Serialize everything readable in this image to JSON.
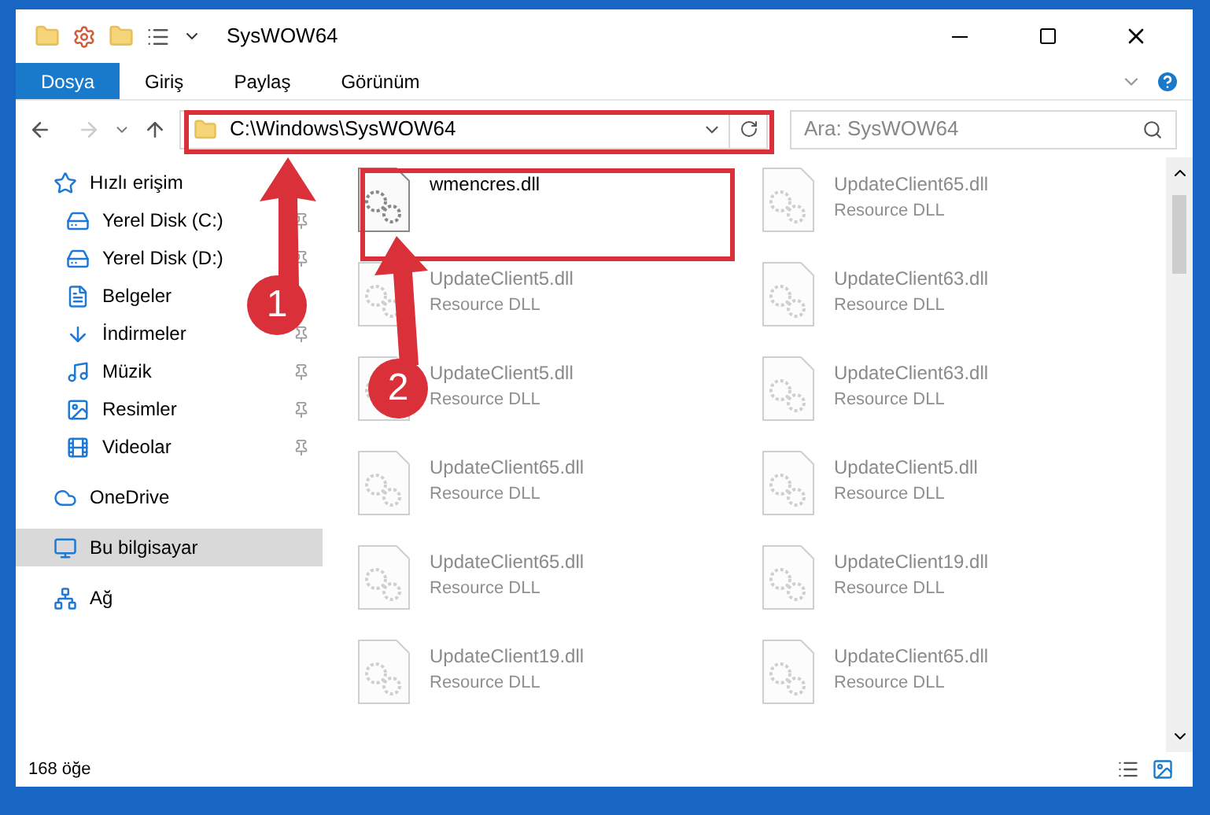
{
  "window": {
    "title": "SysWOW64"
  },
  "ribbon_tabs": [
    {
      "label": "Dosya",
      "selected": true
    },
    {
      "label": "Giriş",
      "selected": false
    },
    {
      "label": "Paylaş",
      "selected": false
    },
    {
      "label": "Görünüm",
      "selected": false
    }
  ],
  "address_bar": {
    "path": "C:\\Windows\\SysWOW64"
  },
  "search": {
    "placeholder": "Ara: SysWOW64"
  },
  "sidebar": {
    "items": [
      {
        "label": "Hızlı erişim",
        "selected": false,
        "children": [
          {
            "label": "Yerel Disk (C:)",
            "pinned": true
          },
          {
            "label": "Yerel Disk (D:)",
            "pinned": true
          },
          {
            "label": "Belgeler"
          },
          {
            "label": "İndirmeler",
            "pinned": true
          },
          {
            "label": "Müzik",
            "pinned": true
          },
          {
            "label": "Resimler",
            "pinned": true
          },
          {
            "label": "Videolar",
            "pinned": true
          }
        ]
      },
      {
        "label": "OneDrive",
        "selected": false
      },
      {
        "label": "Bu bilgisayar",
        "selected": true
      },
      {
        "label": "Ağ",
        "selected": false
      }
    ]
  },
  "files": [
    {
      "name": "wmencres.dll"
    },
    {
      "name": "UpdateClient65.dll",
      "type": "Resource DLL"
    },
    {
      "name": "UpdateClient5.dll",
      "type": "Resource DLL"
    },
    {
      "name": "UpdateClient63.dll",
      "type": "Resource DLL"
    },
    {
      "name": "UpdateClient5.dll",
      "type": "Resource DLL"
    },
    {
      "name": "UpdateClient63.dll",
      "type": "Resource DLL"
    },
    {
      "name": "UpdateClient65.dll",
      "type": "Resource DLL"
    },
    {
      "name": "UpdateClient5.dll",
      "type": "Resource DLL"
    },
    {
      "name": "UpdateClient65.dll",
      "type": "Resource DLL"
    },
    {
      "name": "UpdateClient19.dll",
      "type": "Resource DLL"
    },
    {
      "name": "UpdateClient19.dll",
      "type": "Resource DLL"
    },
    {
      "name": "UpdateClient65.dll",
      "type": "Resource DLL"
    }
  ],
  "status_bar": {
    "count": "168 öğe"
  },
  "annotations": [
    {
      "number": "1"
    },
    {
      "number": "2"
    }
  ]
}
